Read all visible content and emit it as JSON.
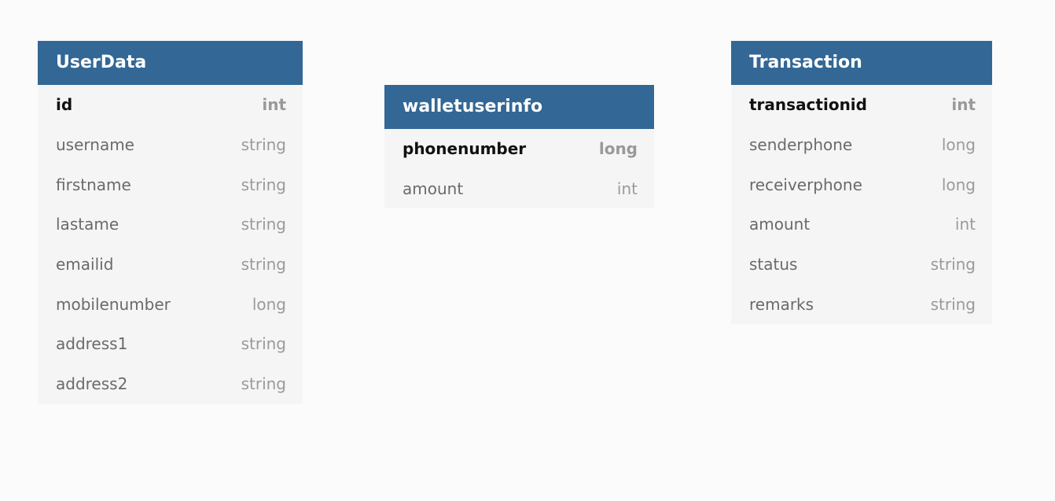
{
  "tables": [
    {
      "name": "UserData",
      "fields": [
        {
          "name": "id",
          "type": "int",
          "pk": true
        },
        {
          "name": "username",
          "type": "string",
          "pk": false
        },
        {
          "name": "firstname",
          "type": "string",
          "pk": false
        },
        {
          "name": "lastame",
          "type": "string",
          "pk": false
        },
        {
          "name": "emailid",
          "type": "string",
          "pk": false
        },
        {
          "name": "mobilenumber",
          "type": "long",
          "pk": false
        },
        {
          "name": "address1",
          "type": "string",
          "pk": false
        },
        {
          "name": "address2",
          "type": "string",
          "pk": false
        }
      ]
    },
    {
      "name": "walletuserinfo",
      "fields": [
        {
          "name": "phonenumber",
          "type": "long",
          "pk": true
        },
        {
          "name": "amount",
          "type": "int",
          "pk": false
        }
      ]
    },
    {
      "name": "Transaction",
      "fields": [
        {
          "name": "transactionid",
          "type": "int",
          "pk": true
        },
        {
          "name": "senderphone",
          "type": "long",
          "pk": false
        },
        {
          "name": "receiverphone",
          "type": "long",
          "pk": false
        },
        {
          "name": "amount",
          "type": "int",
          "pk": false
        },
        {
          "name": "status",
          "type": "string",
          "pk": false
        },
        {
          "name": "remarks",
          "type": "string",
          "pk": false
        }
      ]
    }
  ],
  "colors": {
    "header_bg": "#336795",
    "header_text": "#ffffff",
    "body_bg": "#f5f5f5",
    "canvas_bg": "#fbfbfb",
    "pk_text": "#111111",
    "field_text": "#6a6a6a",
    "type_text": "#9a9a9a"
  }
}
